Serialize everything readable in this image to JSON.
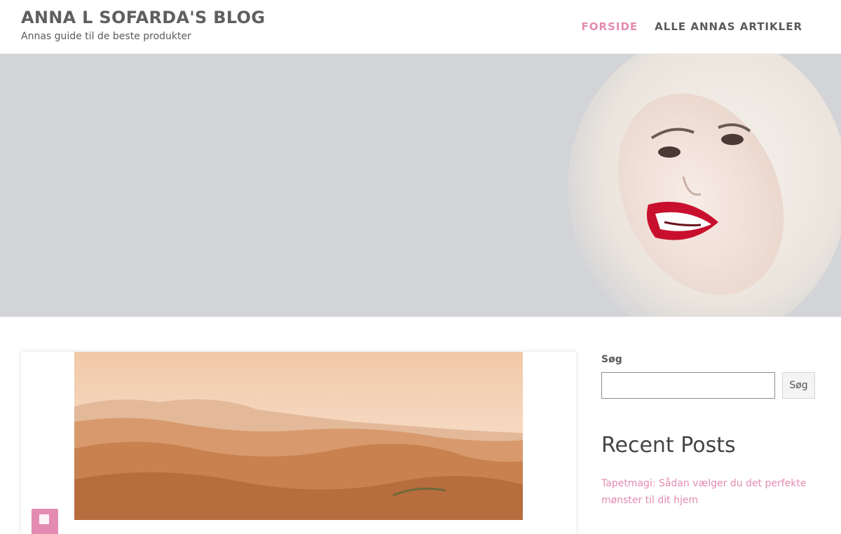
{
  "header": {
    "title": "ANNA L SOFARDA'S BLOG",
    "tagline": "Annas guide til de beste produkter",
    "nav": [
      {
        "label": "FORSIDE",
        "active": true
      },
      {
        "label": "ALLE ANNAS ARTIKLER",
        "active": false
      }
    ]
  },
  "hero": {
    "image": "smiling-woman-in-fur-hood",
    "background_color": "#d3d4d7"
  },
  "post": {
    "image": "desert-sand-dunes",
    "badge_icon": "post-format-icon"
  },
  "sidebar": {
    "search_label": "Søg",
    "search_value": "",
    "search_button": "Søg",
    "recent_title": "Recent Posts",
    "recent_posts": [
      "Tapetmagi: Sådan vælger du det perfekte mønster til dit hjem"
    ]
  },
  "colors": {
    "accent": "#e38bb0",
    "text": "#5a5a5a"
  }
}
